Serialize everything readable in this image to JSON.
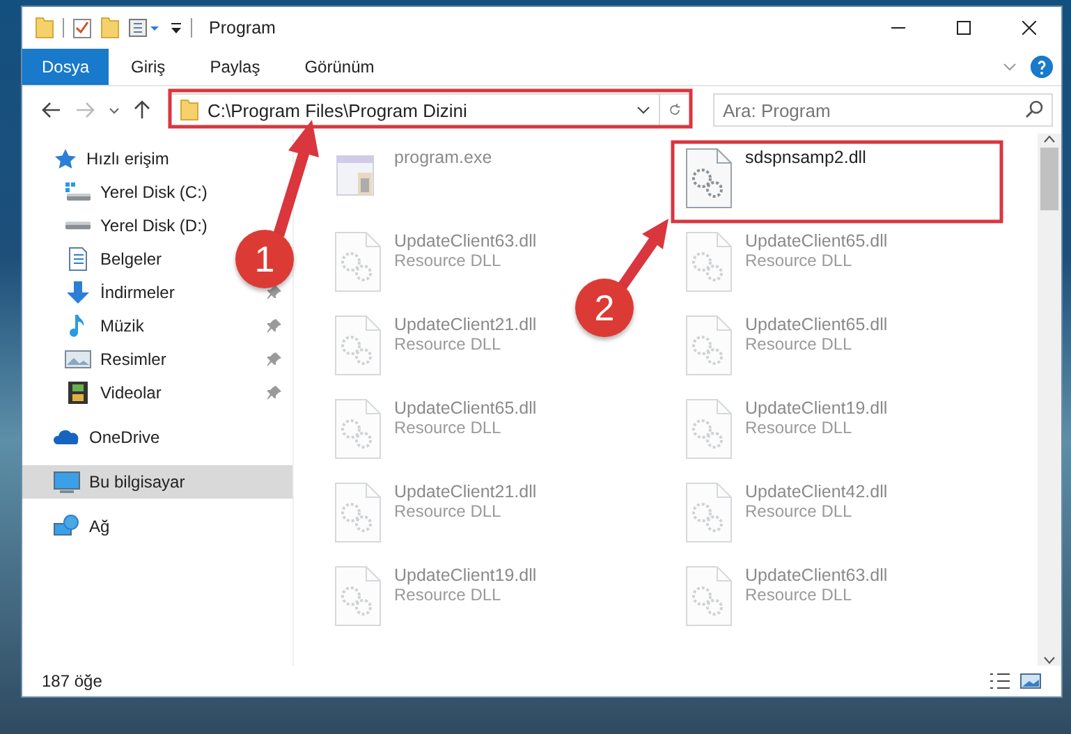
{
  "window": {
    "title": "Program"
  },
  "ribbon": {
    "tabs": [
      {
        "label": "Dosya",
        "selected": true
      },
      {
        "label": "Giriş",
        "selected": false
      },
      {
        "label": "Paylaş",
        "selected": false
      },
      {
        "label": "Görünüm",
        "selected": false
      }
    ]
  },
  "address_bar": {
    "path": "C:\\Program Files\\Program Dizini",
    "search": {
      "placeholder": "Ara: Program"
    }
  },
  "sidebar": {
    "items": [
      {
        "label": "Hızlı erişim",
        "selected": false,
        "children": [
          {
            "label": "Yerel Disk (C:)",
            "selected": false
          },
          {
            "label": "Yerel Disk (D:)",
            "selected": false
          },
          {
            "label": "Belgeler",
            "selected": false
          },
          {
            "label": "İndirmeler",
            "pinned": true,
            "selected": false
          },
          {
            "label": "Müzik",
            "pinned": true,
            "selected": false
          },
          {
            "label": "Resimler",
            "pinned": true,
            "selected": false
          },
          {
            "label": "Videolar",
            "pinned": true,
            "selected": false
          }
        ]
      },
      {
        "label": "OneDrive",
        "selected": false
      },
      {
        "label": "Bu bilgisayar",
        "selected": true
      },
      {
        "label": "Ağ",
        "selected": false
      }
    ]
  },
  "files": [
    {
      "name": "program.exe",
      "kind": "exe",
      "faded": true
    },
    {
      "name": "sdspnsamp2.dll",
      "kind": "dll",
      "faded": false
    },
    {
      "name": "UpdateClient63.dll",
      "type": "Resource DLL",
      "kind": "dll",
      "faded": true
    },
    {
      "name": "UpdateClient65.dll",
      "type": "Resource DLL",
      "kind": "dll",
      "faded": true
    },
    {
      "name": "UpdateClient21.dll",
      "type": "Resource DLL",
      "kind": "dll",
      "faded": true
    },
    {
      "name": "UpdateClient65.dll",
      "type": "Resource DLL",
      "kind": "dll",
      "faded": true
    },
    {
      "name": "UpdateClient65.dll",
      "type": "Resource DLL",
      "kind": "dll",
      "faded": true
    },
    {
      "name": "UpdateClient19.dll",
      "type": "Resource DLL",
      "kind": "dll",
      "faded": true
    },
    {
      "name": "UpdateClient21.dll",
      "type": "Resource DLL",
      "kind": "dll",
      "faded": true
    },
    {
      "name": "UpdateClient42.dll",
      "type": "Resource DLL",
      "kind": "dll",
      "faded": true
    },
    {
      "name": "UpdateClient19.dll",
      "type": "Resource DLL",
      "kind": "dll",
      "faded": true
    },
    {
      "name": "UpdateClient63.dll",
      "type": "Resource DLL",
      "kind": "dll",
      "faded": true
    }
  ],
  "status_bar": {
    "count": "187 öğe"
  },
  "annotations": [
    {
      "label": "1"
    },
    {
      "label": "2"
    }
  ]
}
